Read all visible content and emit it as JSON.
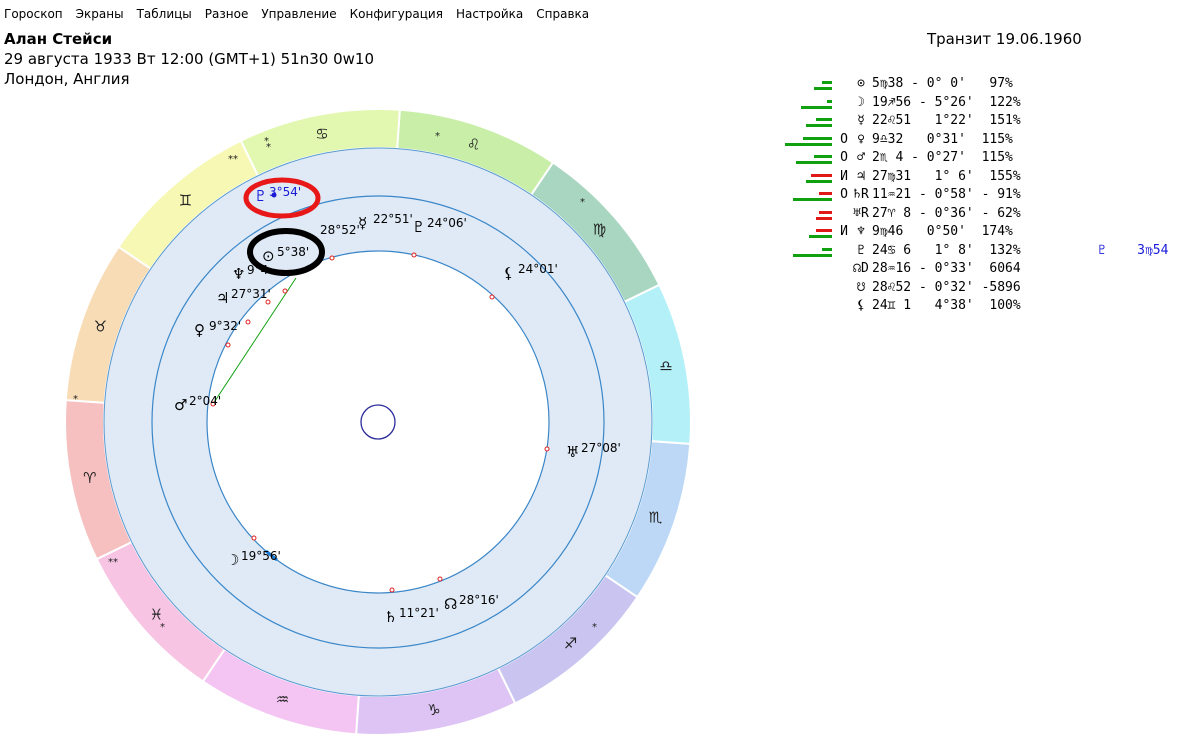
{
  "menu": [
    "Гороскоп",
    "Экраны",
    "Таблицы",
    "Разное",
    "Управление",
    "Конфигурация",
    "Настройка",
    "Справка"
  ],
  "header": {
    "name": "Алан Стейси",
    "line2": "29 августа 1933  Вт  12:00 (GMT+1) 51n30  0w10",
    "line3": "Лондон, Англия",
    "transit": "Транзит 19.06.1960"
  },
  "zodiac_symbols": [
    "♌",
    "♋",
    "♊",
    "♉",
    "♈",
    "♓",
    "♒",
    "♑",
    "♐",
    "♏",
    "♎",
    "♍"
  ],
  "sector_colors": [
    "#c8eea8",
    "#e2f7b0",
    "#f6f8b4",
    "#f8dcb6",
    "#f7c0c0",
    "#f8c4e4",
    "#f4c4f2",
    "#dec4f4",
    "#c9c4f0",
    "#bcd8f6",
    "#b4f0f8",
    "#a8d6c0"
  ],
  "star_marks": [
    "*",
    "**",
    "*",
    "*",
    "*",
    "**",
    "*",
    "*",
    "*"
  ],
  "chart_planets": [
    {
      "glyph": "⊙",
      "label": "5°38'",
      "color": "#000000"
    },
    {
      "glyph": "♇",
      "label": "3°54'",
      "color": "#1a1ad8"
    },
    {
      "glyph": "",
      "label": "28°52'",
      "color": "#000000"
    },
    {
      "glyph": "☿",
      "label": "22°51'",
      "color": "#000000"
    },
    {
      "glyph": "♇",
      "label": "24°06'",
      "color": "#000000"
    },
    {
      "glyph": "⚸",
      "label": "24°01'",
      "color": "#000000"
    },
    {
      "glyph": "♆",
      "label": "9°4",
      "color": "#000000"
    },
    {
      "glyph": "♃",
      "label": "27°31'",
      "color": "#000000"
    },
    {
      "glyph": "♀",
      "label": "9°32'",
      "color": "#000000"
    },
    {
      "glyph": "♂",
      "label": "2°04'",
      "color": "#000000"
    },
    {
      "glyph": "♅",
      "label": "27°08'",
      "color": "#000000"
    },
    {
      "glyph": "☽",
      "label": "19°56'",
      "color": "#000000"
    },
    {
      "glyph": "♄",
      "label": "11°21'",
      "color": "#000000"
    },
    {
      "glyph": "☊",
      "label": "28°16'",
      "color": "#000000"
    }
  ],
  "planet_table": [
    {
      "flag": "",
      "sym": "⊙",
      "text": "5♍38 - 0° 0'   97%",
      "extra": ""
    },
    {
      "flag": "",
      "sym": "☽",
      "text": "19♐56 - 5°26'  122%",
      "extra": ""
    },
    {
      "flag": "",
      "sym": "☿",
      "text": "22♌51   1°22'  151%",
      "extra": ""
    },
    {
      "flag": "O",
      "sym": "♀",
      "text": "9♎32   0°31'  115%",
      "extra": ""
    },
    {
      "flag": "O",
      "sym": "♂",
      "text": "2♏ 4 - 0°27'  115%",
      "extra": ""
    },
    {
      "flag": "И",
      "sym": "♃",
      "text": "27♍31   1° 6'  155%",
      "extra": ""
    },
    {
      "flag": "O",
      "sym": "♄R",
      "text": "11♒21 - 0°58' - 91%",
      "extra": ""
    },
    {
      "flag": "",
      "sym": "♅R",
      "text": "27♈ 8 - 0°36' - 62%",
      "extra": ""
    },
    {
      "flag": "И",
      "sym": "♆",
      "text": "9♍46   0°50'  174%",
      "extra": ""
    },
    {
      "flag": "",
      "sym": "♇",
      "text": "24♋ 6   1° 8'  132%",
      "extra": "♇    3♍54"
    },
    {
      "flag": "",
      "sym": "☊D",
      "text": "28♒16 - 0°33'  6064",
      "extra": ""
    },
    {
      "flag": "",
      "sym": "☋",
      "text": "28♌52 - 0°32' -5896",
      "extra": ""
    },
    {
      "flag": "",
      "sym": "⚸",
      "text": "24♊ 1   4°38'  100%",
      "extra": ""
    }
  ],
  "bar_levels": [
    [
      [
        0.35,
        "g"
      ],
      [
        0.2,
        "g"
      ]
    ],
    [
      [
        0.6,
        "g"
      ],
      [
        0.1,
        "g"
      ]
    ],
    [
      [
        0.5,
        "g"
      ],
      [
        0.3,
        "g"
      ]
    ],
    [
      [
        0.9,
        "g"
      ],
      [
        0.55,
        "g"
      ]
    ],
    [
      [
        0.7,
        "g"
      ],
      [
        0.35,
        "g"
      ]
    ],
    [
      [
        0.5,
        "g"
      ],
      [
        0.4,
        "r"
      ]
    ],
    [
      [
        0.75,
        "g"
      ],
      [
        0.25,
        "r"
      ]
    ],
    [
      [
        0.3,
        "r"
      ],
      [
        0.25,
        "r"
      ]
    ],
    [
      [
        0.45,
        "g"
      ],
      [
        0.3,
        "r"
      ]
    ],
    [
      [
        0.75,
        "g"
      ],
      [
        0.2,
        "g"
      ]
    ]
  ],
  "colors": {
    "green": "#10a010",
    "red": "#e01818",
    "blue": "#1a1ad8"
  }
}
